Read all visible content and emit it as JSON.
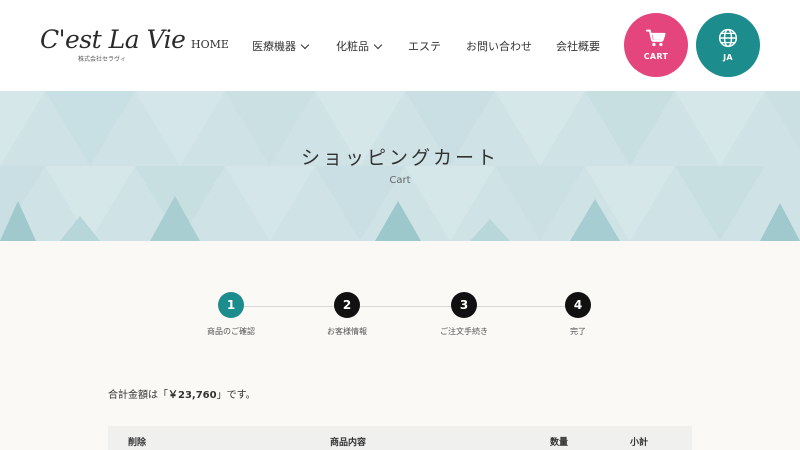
{
  "header": {
    "logo_main": "C'est La Vie",
    "logo_sub": "株式会社セラヴィ",
    "nav": [
      {
        "label": "HOME",
        "has_dropdown": false
      },
      {
        "label": "医療機器",
        "has_dropdown": true
      },
      {
        "label": "化粧品",
        "has_dropdown": true
      },
      {
        "label": "エステ",
        "has_dropdown": false
      },
      {
        "label": "お問い合わせ",
        "has_dropdown": false
      },
      {
        "label": "会社概要",
        "has_dropdown": false
      }
    ],
    "cart_label": "CART",
    "lang_label": "JA"
  },
  "hero": {
    "title": "ショッピングカート",
    "subtitle": "Cart"
  },
  "steps": [
    {
      "number": "1",
      "label": "商品のご確認",
      "active": true
    },
    {
      "number": "2",
      "label": "お客様情報",
      "active": false
    },
    {
      "number": "3",
      "label": "ご注文手続き",
      "active": false
    },
    {
      "number": "4",
      "label": "完了",
      "active": false
    }
  ],
  "total": {
    "prefix": "合計金額は「",
    "amount": "￥23,760",
    "suffix": "」です。"
  },
  "table": {
    "headers": [
      "削除",
      "商品内容",
      "数量",
      "小計"
    ]
  },
  "colors": {
    "accent_teal": "#1d8c8c",
    "cart_pink": "#e4457c",
    "hero_bg": "#cfe3e6"
  },
  "icons": {
    "cart": "cart-icon",
    "lang": "globe-icon"
  }
}
